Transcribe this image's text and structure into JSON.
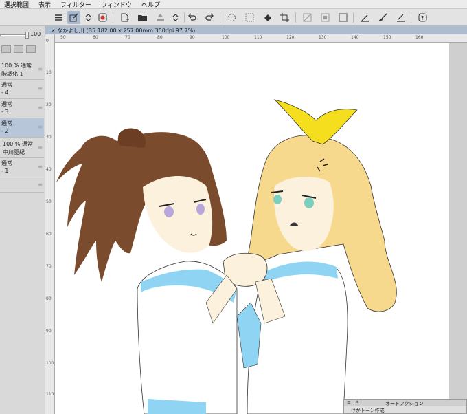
{
  "menu": [
    "選択範囲",
    "表示",
    "フィルター",
    "ウィンドウ",
    "ヘルプ"
  ],
  "toolbar_icons": [
    "menu-icon",
    "transform-icon",
    "chevron-updown-icon",
    "color-picker-icon",
    "new-file-icon",
    "open-folder-icon",
    "save-icon",
    "chevron-updown-icon",
    "undo-icon",
    "redo-icon",
    "loading-icon",
    "filter-icon",
    "fill-icon",
    "crop-icon",
    "selection-clear-icon",
    "selection-invert-icon",
    "selection-border-icon",
    "ruler-pen-icon",
    "brush-icon",
    "brush-stroke-icon",
    "help-icon"
  ],
  "left_panel": {
    "opacity_value": "100",
    "layers": [
      {
        "line1": "100 % 通常",
        "line2": "階調化 1"
      },
      {
        "line1": "通常",
        "line2": "- 4"
      },
      {
        "line1": "通常",
        "line2": "- 3"
      },
      {
        "line1": "通常",
        "line2": "- 2"
      },
      {
        "line1": "100 % 通常",
        "line2": "中川夏紀"
      },
      {
        "line1": "通常",
        "line2": "- 1"
      }
    ]
  },
  "canvas_tab": "× なかよし川 (B5 182.00 x 257.00mm 350dpi 97.7%)",
  "ruler_h": [
    "50",
    "60",
    "70",
    "80",
    "90",
    "100",
    "110",
    "120",
    "130",
    "140",
    "150",
    "160"
  ],
  "ruler_v": [
    "0",
    "10",
    "20",
    "30",
    "40",
    "50",
    "60",
    "70",
    "80",
    "90",
    "100",
    "110",
    "120",
    "130"
  ],
  "auto_action": {
    "title": "オートアクション",
    "item": "けがトーン作成"
  },
  "colors": {
    "accent": "#aebcd0",
    "selected_layer": "#b7c6d9",
    "hair_brown": "#7a4a2e",
    "hair_blonde": "#f6d88a",
    "ribbon": "#f5de1e",
    "uniform_blue": "#8fd4f2",
    "skin": "#fcf1dc"
  }
}
